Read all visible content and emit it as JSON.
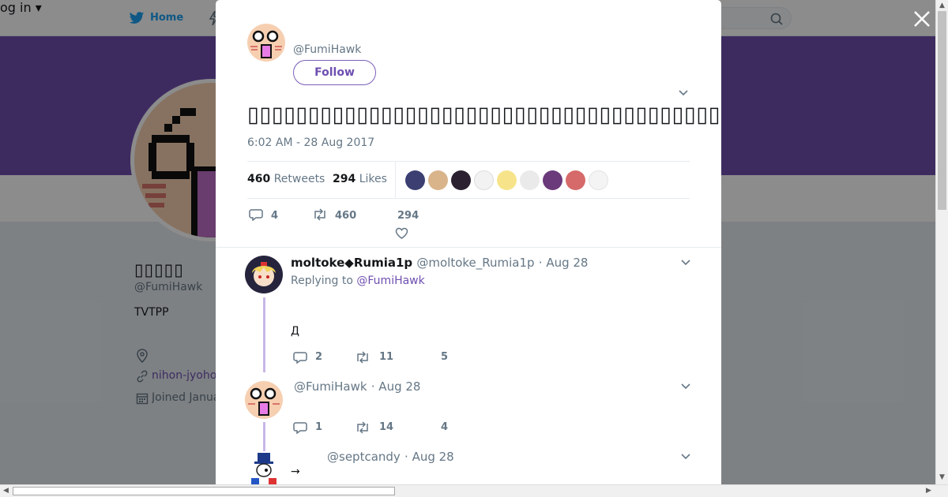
{
  "topbar": {
    "home_label": "Home",
    "login_fragment": "og in ▾"
  },
  "profile": {
    "name": "▯▯▯▯▯",
    "handle": "@FumiHawk",
    "bio": "TVTPP",
    "link": "nihon-jyoho",
    "joined": "Joined Janua"
  },
  "tweet": {
    "author_handle": "@FumiHawk",
    "follow_label": "Follow",
    "text": "▯▯▯▯▯▯▯▯▯▯▯▯▯▯▯▯▯▯▯▯▯▯▯▯▯▯▯▯▯▯▯▯▯▯▯▯▯▯▯▯▯▯▯▯▯▯▯",
    "timestamp": "6:02 AM - 28 Aug 2017",
    "retweets_count": "460",
    "retweets_label": "Retweets",
    "likes_count": "294",
    "likes_label": "Likes",
    "reply_count": "4",
    "retweet_action_count": "460",
    "like_action_count": "294"
  },
  "replies": [
    {
      "name": "moltoke◆Rumia1p",
      "handle": "@moltoke_Rumia1p",
      "date": "· Aug 28",
      "replying_prefix": "Replying to",
      "replying_to": "@FumiHawk",
      "body": "Д",
      "reply_count": "2",
      "retweet_count": "11",
      "like_count": "5"
    },
    {
      "handle": "@FumiHawk",
      "date": "· Aug 28",
      "reply_count": "1",
      "retweet_count": "14",
      "like_count": "4"
    },
    {
      "handle": "@septcandy",
      "date": "· Aug 28",
      "body": "→"
    }
  ],
  "colors": {
    "accent": "#6f4fb0",
    "banner": "#6f4fb0",
    "twitter_blue": "#1da1f2"
  }
}
